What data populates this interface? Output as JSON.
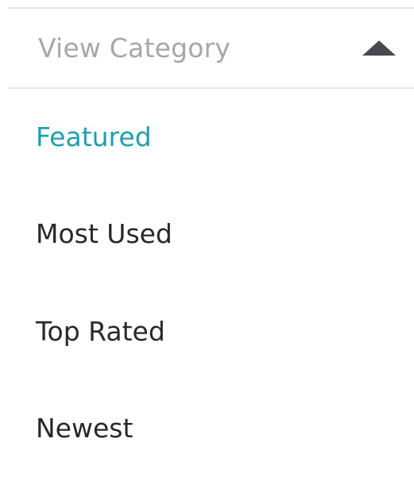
{
  "dropdown": {
    "label": "View Category",
    "state": "expanded",
    "caret_icon": "caret-up-icon",
    "label_color": "#a6a7ad",
    "caret_color": "#48494f"
  },
  "options": [
    {
      "label": "Featured",
      "selected": true
    },
    {
      "label": "Most Used",
      "selected": false
    },
    {
      "label": "Top Rated",
      "selected": false
    },
    {
      "label": "Newest",
      "selected": false
    }
  ],
  "colors": {
    "selected_text": "#1f9fb0",
    "option_text": "#27282d",
    "divider": "#e4e4e6"
  }
}
